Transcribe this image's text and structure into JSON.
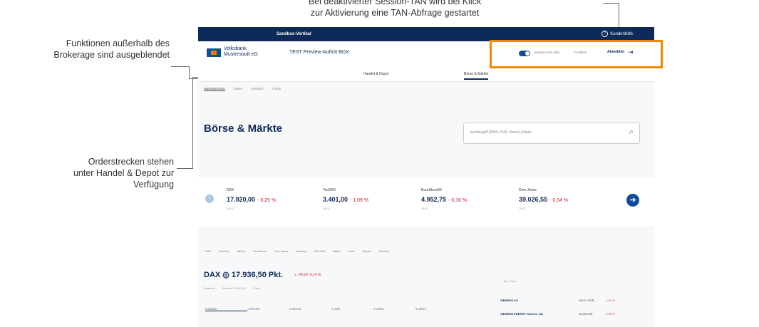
{
  "annotations": {
    "session_tan": [
      "Bei deaktivierter Session-TAN wird bei Klick",
      "zur Aktivierung eine TAN-Abfrage gestartet"
    ],
    "hidden_functions": [
      "Funktionen außerhalb des",
      "Brokerage sind ausgeblendet"
    ],
    "order_routes": [
      "Orderstrecken stehen",
      "unter Handel & Depot zur",
      "Verfügung"
    ]
  },
  "topbar": {
    "tab_label": "Sandbox-Vertikal",
    "help_label": "Kundenhilfe"
  },
  "header": {
    "bank_name": [
      "Volksbank",
      "Musterstadt eG"
    ],
    "app_title": "TEST Preview-Auftritt BOX",
    "toggle_label": "Session-TAN aktiv",
    "link_postbox": "Postfach",
    "logout_label": "Abmelden"
  },
  "nav": {
    "items": [
      "Handel & Depot",
      "Börse & Märkte"
    ]
  },
  "subnav": [
    "Marktübersicht",
    "Aktien",
    "Anleihen",
    "Fonds"
  ],
  "page": {
    "title": "Börse & Märkte",
    "search_placeholder": "Suchbegriff (WKN, ISIN, Name) | News"
  },
  "ticker": {
    "quotes": [
      {
        "name": "DAX",
        "value": "17.920,00",
        "change": "- 0,25 %",
        "sub": "18:01"
      },
      {
        "name": "TecDAX",
        "value": "3.401,00",
        "change": "- 1,09 %",
        "sub": "18:01"
      },
      {
        "name": "EuroStoxx50",
        "value": "4.952,75",
        "change": "- 0,16 %",
        "sub": "18:01"
      },
      {
        "name": "Dow Jones",
        "value": "39.026,55",
        "change": "- 0,04 %",
        "sub": "18:01"
      }
    ]
  },
  "index_tabs": [
    "DAX",
    "TecDAX",
    "MDAX",
    "EuroStoxx",
    "Dow Jones",
    "Nasdaq",
    "S&P 500",
    "Nikkei",
    "Gold",
    "Ölpreis",
    "Devisen"
  ],
  "dax": {
    "title": "DAX ◎ 17.936,50 Pkt.",
    "change": "↘ -24,50  -0,14 %",
    "subs": [
      "Realtime",
      "Schluss 17.961,00",
      "Chart"
    ],
    "chart_tabs": [
      "Intraday",
      "1 Woche",
      "1 Monat",
      "1 Jahr",
      "3 Jahre",
      "5 Jahre"
    ]
  },
  "sidebar": {
    "heading": "Top / Flop",
    "rows": [
      {
        "name": "SIEMENS AG",
        "value": "160,12 EUR",
        "change": "-1,21 %"
      },
      {
        "name": "SIEMENS ENERGY N.A.N.S. DA",
        "value": "18,40 EUR",
        "change": "-1,09 %"
      }
    ]
  }
}
